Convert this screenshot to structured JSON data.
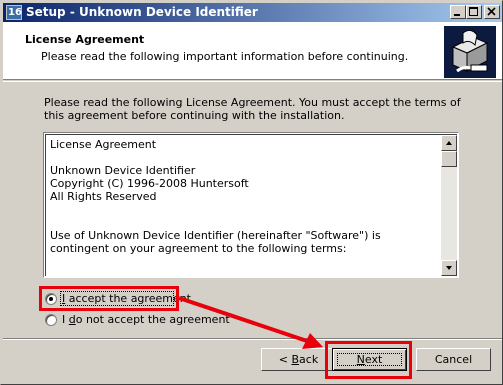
{
  "window": {
    "title": "Setup - Unknown Device Identifier"
  },
  "header": {
    "title": "License Agreement",
    "subtitle": "Please read the following important information before continuing."
  },
  "intro": "Please read the following License Agreement. You must accept the terms of this agreement before continuing with the installation.",
  "license": {
    "text": "License Agreement\n\nUnknown Device Identifier\nCopyright (C) 1996-2008 Huntersoft\nAll Rights Reserved\n\n\nUse of Unknown Device Identifier (hereinafter \"Software\") is contingent on your agreement to the following terms:"
  },
  "options": {
    "accept": {
      "accel": "I",
      "rest": " accept the agreement",
      "checked": true
    },
    "decline": {
      "prefix": "I ",
      "accel": "d",
      "rest": "o not accept the agreement",
      "checked": false
    }
  },
  "buttons": {
    "back": {
      "prefix": "< ",
      "accel": "B",
      "rest": "ack"
    },
    "next": {
      "accel": "N",
      "rest": "ext"
    },
    "cancel": {
      "label": "Cancel"
    }
  },
  "annotation": {
    "color": "#e8000b"
  },
  "icons": {
    "app": "setup-app-icon",
    "header": "installer-box-icon"
  }
}
